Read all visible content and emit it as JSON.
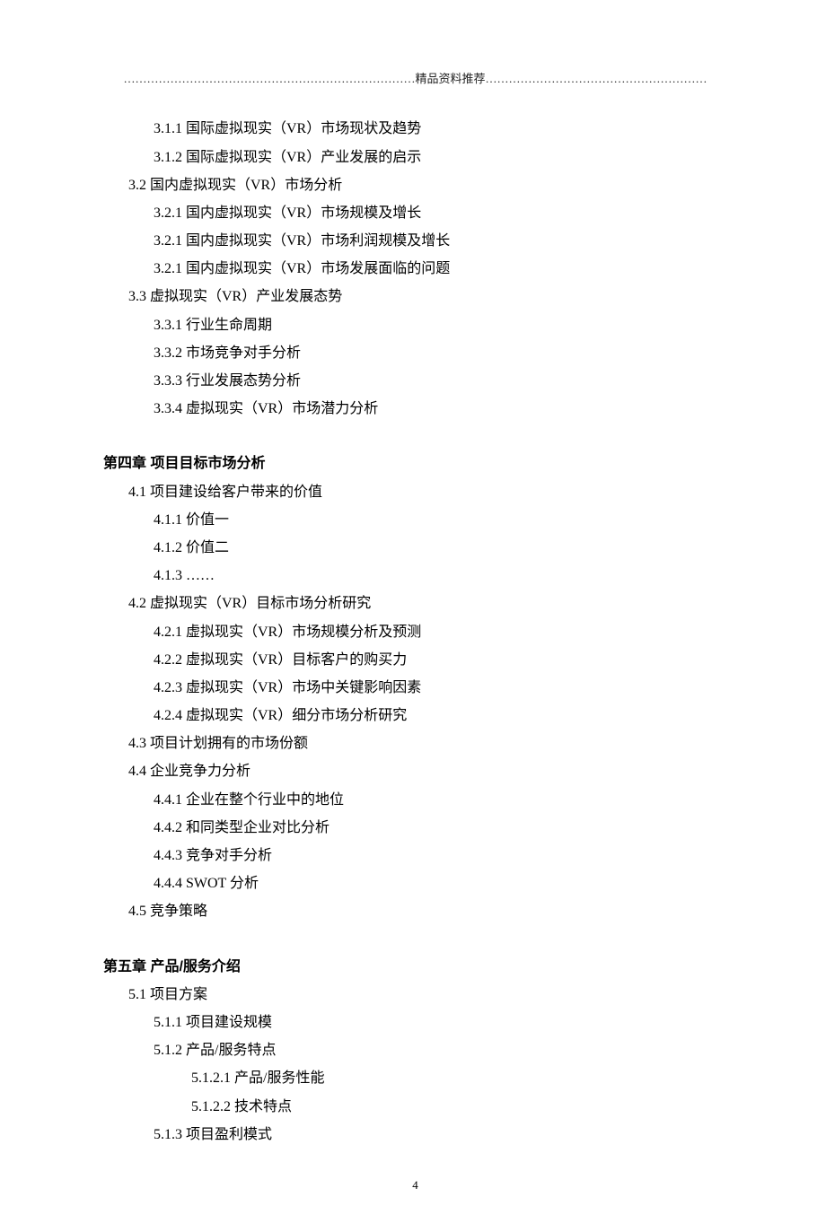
{
  "header": "…………………………………………………………………精品资料推荐…………………………………………………",
  "lines": [
    {
      "text": "3.1.1 国际虚拟现实（VR）市场现状及趋势",
      "cls": "lvl3"
    },
    {
      "text": "3.1.2 国际虚拟现实（VR）产业发展的启示",
      "cls": "lvl3"
    },
    {
      "text": "3.2 国内虚拟现实（VR）市场分析",
      "cls": "lvl2"
    },
    {
      "text": "3.2.1 国内虚拟现实（VR）市场规模及增长",
      "cls": "lvl3"
    },
    {
      "text": "3.2.1 国内虚拟现实（VR）市场利润规模及增长",
      "cls": "lvl3"
    },
    {
      "text": "3.2.1 国内虚拟现实（VR）市场发展面临的问题",
      "cls": "lvl3"
    },
    {
      "text": "3.3 虚拟现实（VR）产业发展态势",
      "cls": "lvl2"
    },
    {
      "text": "3.3.1 行业生命周期",
      "cls": "lvl3"
    },
    {
      "text": "3.3.2 市场竞争对手分析",
      "cls": "lvl3"
    },
    {
      "text": "3.3.3 行业发展态势分析",
      "cls": "lvl3"
    },
    {
      "text": "3.3.4 虚拟现实（VR）市场潜力分析",
      "cls": "lvl3"
    },
    {
      "text": "第四章 项目目标市场分析",
      "cls": "chapter"
    },
    {
      "text": "4.1 项目建设给客户带来的价值",
      "cls": "lvl2"
    },
    {
      "text": "4.1.1 价值一",
      "cls": "lvl3"
    },
    {
      "text": "4.1.2 价值二",
      "cls": "lvl3"
    },
    {
      "text": "4.1.3 ……",
      "cls": "lvl3"
    },
    {
      "text": "4.2 虚拟现实（VR）目标市场分析研究",
      "cls": "lvl2"
    },
    {
      "text": "4.2.1 虚拟现实（VR）市场规模分析及预测",
      "cls": "lvl3"
    },
    {
      "text": "4.2.2 虚拟现实（VR）目标客户的购买力",
      "cls": "lvl3"
    },
    {
      "text": "4.2.3 虚拟现实（VR）市场中关键影响因素",
      "cls": "lvl3"
    },
    {
      "text": "4.2.4 虚拟现实（VR）细分市场分析研究",
      "cls": "lvl3"
    },
    {
      "text": "4.3 项目计划拥有的市场份额",
      "cls": "lvl2"
    },
    {
      "text": "4.4 企业竞争力分析",
      "cls": "lvl2"
    },
    {
      "text": "4.4.1 企业在整个行业中的地位",
      "cls": "lvl3"
    },
    {
      "text": "4.4.2 和同类型企业对比分析",
      "cls": "lvl3"
    },
    {
      "text": "4.4.3 竞争对手分析",
      "cls": "lvl3"
    },
    {
      "text": "4.4.4 SWOT 分析",
      "cls": "lvl3"
    },
    {
      "text": "4.5 竞争策略",
      "cls": "lvl2"
    },
    {
      "text": "第五章 产品/服务介绍",
      "cls": "chapter"
    },
    {
      "text": "5.1 项目方案",
      "cls": "lvl2"
    },
    {
      "text": "5.1.1 项目建设规模",
      "cls": "lvl3"
    },
    {
      "text": "5.1.2 产品/服务特点",
      "cls": "lvl3"
    },
    {
      "text": "5.1.2.1 产品/服务性能",
      "cls": "lvl4"
    },
    {
      "text": "5.1.2.2 技术特点",
      "cls": "lvl4"
    },
    {
      "text": "5.1.3 项目盈利模式",
      "cls": "lvl3"
    }
  ],
  "page_number": "4"
}
